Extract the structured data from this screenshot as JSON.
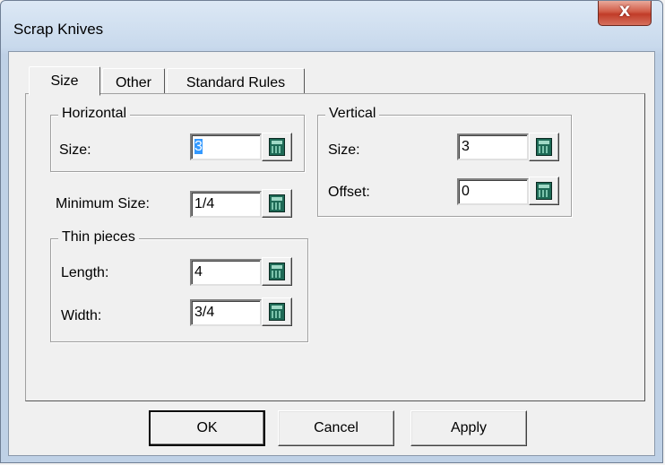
{
  "window": {
    "title": "Scrap Knives",
    "close_label": "X"
  },
  "tabs": [
    {
      "label": "Size",
      "active": true
    },
    {
      "label": "Other",
      "active": false
    },
    {
      "label": "Standard Rules",
      "active": false
    }
  ],
  "horizontal": {
    "legend": "Horizontal",
    "size_label": "Size:",
    "size_value": "3"
  },
  "vertical": {
    "legend": "Vertical",
    "size_label": "Size:",
    "size_value": "3",
    "offset_label": "Offset:",
    "offset_value": "0"
  },
  "minimum": {
    "label": "Minimum Size:",
    "value": "1/4"
  },
  "thin_pieces": {
    "legend": "Thin pieces",
    "length_label": "Length:",
    "length_value": "4",
    "width_label": "Width:",
    "width_value": "3/4"
  },
  "buttons": {
    "ok": "OK",
    "cancel": "Cancel",
    "apply": "Apply"
  },
  "icons": {
    "close": "close-icon",
    "calculator": "calculator-icon"
  }
}
